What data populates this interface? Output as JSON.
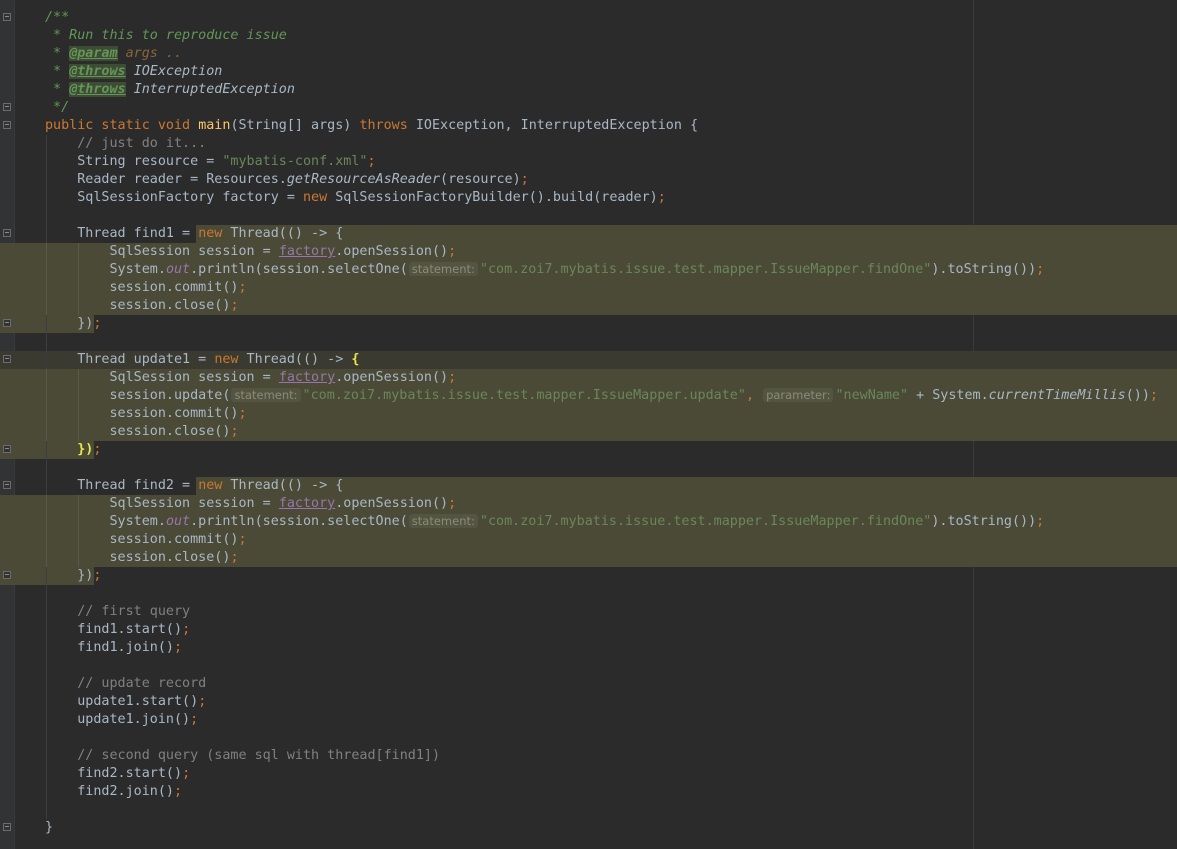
{
  "editor": {
    "doc_comment": {
      "open": "/**",
      "line1": " * Run this to reproduce issue",
      "param_tag": "@param",
      "param_name": "args ..",
      "throws_tag": "@throws",
      "throws1": "IOException",
      "throws2": "InterruptedException",
      "close": " */"
    },
    "signature": {
      "modifiers": "public static void",
      "method": "main",
      "params": "(String[] args)",
      "throws_kw": "throws",
      "exceptions": "IOException, InterruptedException {"
    },
    "comments": {
      "just_do_it": "// just do it...",
      "first_query": "// first query",
      "update_record": "// update record",
      "second_query": "// second query (same sql with thread[find1])"
    },
    "setup": {
      "resource_decl": "String resource = ",
      "resource_value": "\"mybatis-conf.xml\"",
      "reader_decl": "Reader reader = Resources.",
      "reader_call": "getResourceAsReader",
      "reader_arg": "(resource)",
      "factory_decl": "SqlSessionFactory factory = ",
      "factory_call": "SqlSessionFactoryBuilder().build(reader)"
    },
    "threads": {
      "find1_decl": "Thread find1 = ",
      "update1_decl": "Thread update1 = ",
      "find2_decl": "Thread find2 = ",
      "new_kw": "new",
      "thread_ctor": " Thread(() -> ",
      "open_brace": "{",
      "close": "})",
      "session_decl": "SqlSession session = ",
      "factory_ref": "factory",
      "open_session": ".openSession()",
      "sysout_prefix": "System.",
      "out_field": "out",
      "println_select": ".println(session.selectOne(",
      "hint_statement": "statement:",
      "find_one_stmt": "\"com.zoi7.mybatis.issue.test.mapper.IssueMapper.findOne\"",
      "to_string": ").toString())",
      "update_call": "session.update(",
      "update_stmt": "\"com.zoi7.mybatis.issue.test.mapper.IssueMapper.update\"",
      "hint_parameter": "parameter:",
      "new_name": "\"newName\"",
      "plus_system": " + System.",
      "current_time": "currentTimeMillis",
      "call_end": "())",
      "commit": "session.commit()",
      "close_session": "session.close()"
    },
    "calls": {
      "find1_start": "find1.start()",
      "find1_join": "find1.join()",
      "update1_start": "update1.start()",
      "update1_join": "update1.join()",
      "find2_start": "find2.start()",
      "find2_join": "find2.join()"
    },
    "closing_brace": "}",
    "semicolon": ";",
    "comma": ",",
    "colors": {
      "background": "#2b2b2b",
      "keyword": "#cc7832",
      "string": "#6a8759",
      "comment": "#808080",
      "doc": "#629755",
      "function": "#ffc66d",
      "highlight": "#4a4a36"
    },
    "icons": [
      "fold-marker-icon"
    ]
  }
}
